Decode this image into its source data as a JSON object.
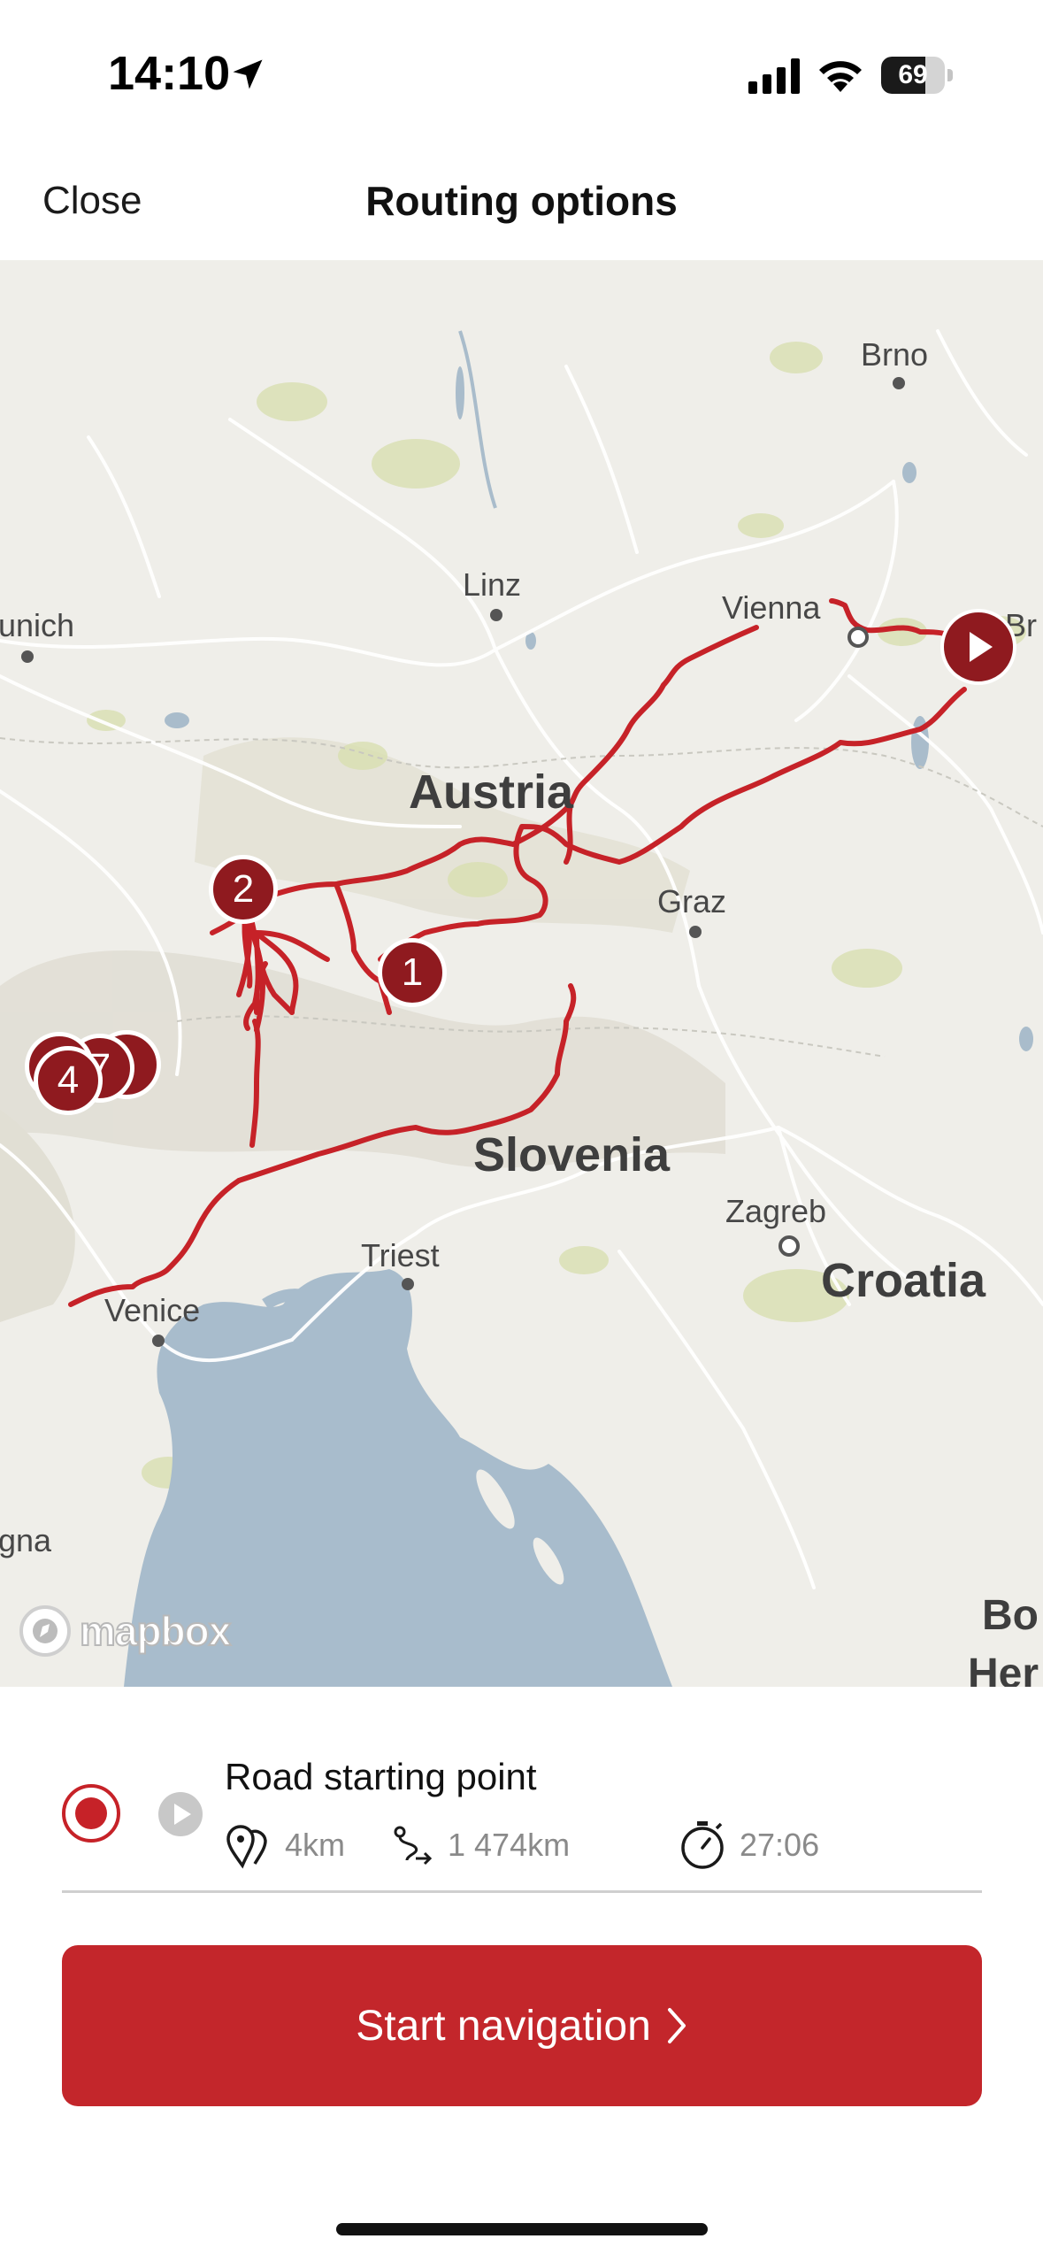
{
  "status_bar": {
    "time": "14:10",
    "battery": "69",
    "battery_level": 0.69,
    "icons": [
      "location-arrow-icon",
      "cellular-signal-icon",
      "wifi-icon",
      "battery-icon"
    ]
  },
  "header": {
    "close_label": "Close",
    "title": "Routing options"
  },
  "map": {
    "cities": {
      "brno": "Brno",
      "linz": "Linz",
      "munich": "unich",
      "vienna": "Vienna",
      "bratislava": "Br",
      "graz": "Graz",
      "triest": "Triest",
      "venice": "Venice",
      "zagreb": "Zagreb",
      "bologna": "gna",
      "bosnia": "Bo",
      "herz": "Her"
    },
    "countries": {
      "austria": "Austria",
      "slovenia": "Slovenia",
      "croatia": "Croatia"
    },
    "waypoints": {
      "w1": "1",
      "w2": "2",
      "w4": "4",
      "w7": "7"
    },
    "attribution": "mapbox",
    "route_color": "#c62228",
    "marker_color": "#8f1a1f"
  },
  "route": {
    "title": "Road starting point",
    "distance_to_start": "4km",
    "total_distance": "1 474km",
    "duration": "27:06"
  },
  "actions": {
    "start_navigation": "Start navigation"
  },
  "colors": {
    "accent": "#c3262b"
  }
}
